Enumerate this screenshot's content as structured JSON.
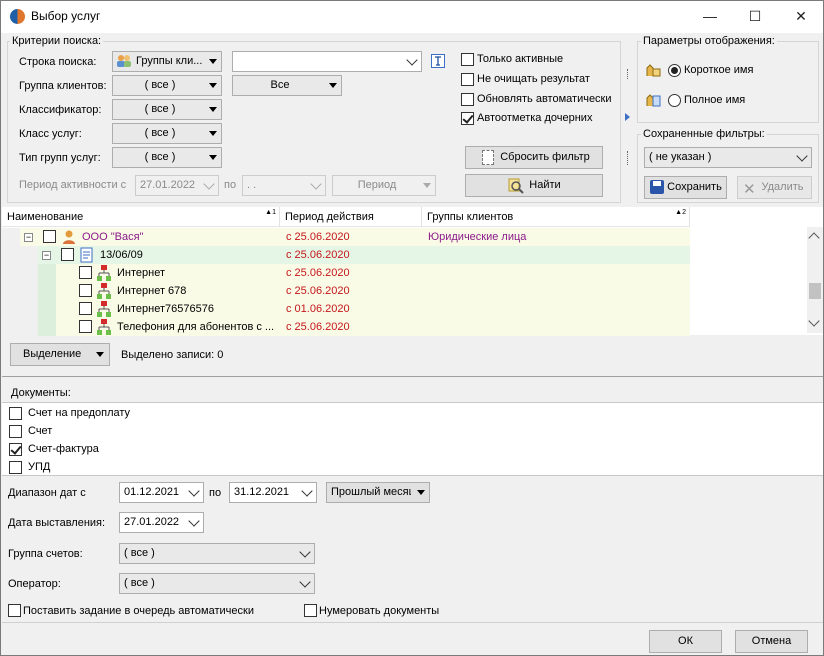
{
  "window": {
    "title": "Выбор услуг",
    "minimize": "—",
    "maximize": "☐",
    "close": "✕"
  },
  "search": {
    "group_title": "Критерии поиска:",
    "row_search_label": "Строка поиска:",
    "search_type_value": "Группы кли...",
    "search_text_value": "",
    "row_group_label": "Группа клиентов:",
    "group_clients_value": "( все )",
    "group_clients_all": "Все",
    "row_classifier_label": "Классификатор:",
    "classifier_value": "( все )",
    "row_class_label": "Класс услуг:",
    "class_value": "( все )",
    "row_type_label": "Тип групп услуг:",
    "type_value": "( все )",
    "period_label": "Период активности с",
    "period_from": "27.01.2022",
    "period_to_label": "по",
    "period_to": " .  .",
    "period_button": "Период",
    "only_active": "Только активные",
    "dont_clear": "Не очищать результат",
    "auto_refresh": "Обновлять автоматически",
    "auto_mark_children": "Автоотметка дочерних",
    "reset_filter": "Сбросить фильтр",
    "find": "Найти"
  },
  "display": {
    "group_title": "Параметры отображения:",
    "short_name": "Короткое имя",
    "full_name": "Полное имя"
  },
  "saved_filters": {
    "group_title": "Сохраненные фильтры:",
    "value": "( не указан )",
    "save": "Сохранить",
    "delete": "Удалить"
  },
  "tree": {
    "columns": [
      "Наименование",
      "Период действия",
      "Группы клиентов"
    ],
    "sort1": "▲1",
    "sort2": "▲2",
    "rows": [
      {
        "name": "ООО \"Вася\"",
        "period": "с 25.06.2020",
        "group": "Юридические лица"
      },
      {
        "name": "13/06/09",
        "period": "с 25.06.2020",
        "group": ""
      },
      {
        "name": "Интернет",
        "period": "с 25.06.2020",
        "group": ""
      },
      {
        "name": "Интернет 678",
        "period": "с 25.06.2020",
        "group": ""
      },
      {
        "name": "Интернет76576576",
        "period": "с 01.06.2020",
        "group": ""
      },
      {
        "name": "Телефония для абонентов с ...",
        "period": "с 25.06.2020",
        "group": ""
      }
    ]
  },
  "selection": {
    "button": "Выделение",
    "status": "Выделено  записи: 0"
  },
  "documents": {
    "title": "Документы:",
    "items": [
      {
        "label": "Счет на предоплату",
        "checked": false
      },
      {
        "label": "Счет",
        "checked": false
      },
      {
        "label": "Счет-фактура",
        "checked": true
      },
      {
        "label": "УПД",
        "checked": false
      }
    ]
  },
  "dates": {
    "range_label": "Диапазон дат с",
    "range_from": "01.12.2021",
    "range_to_label": "по",
    "range_to": "31.12.2021",
    "preset": "Прошлый месяц",
    "issue_label": "Дата выставления:",
    "issue_date": "27.01.2022"
  },
  "accounts": {
    "group_label": "Группа счетов:",
    "group_value": "( все )",
    "operator_label": "Оператор:",
    "operator_value": "( все )"
  },
  "options": {
    "queue_auto": "Поставить задание в очередь автоматически",
    "number_docs": "Нумеровать документы"
  },
  "footer": {
    "ok": "ОК",
    "cancel": "Отмена"
  }
}
